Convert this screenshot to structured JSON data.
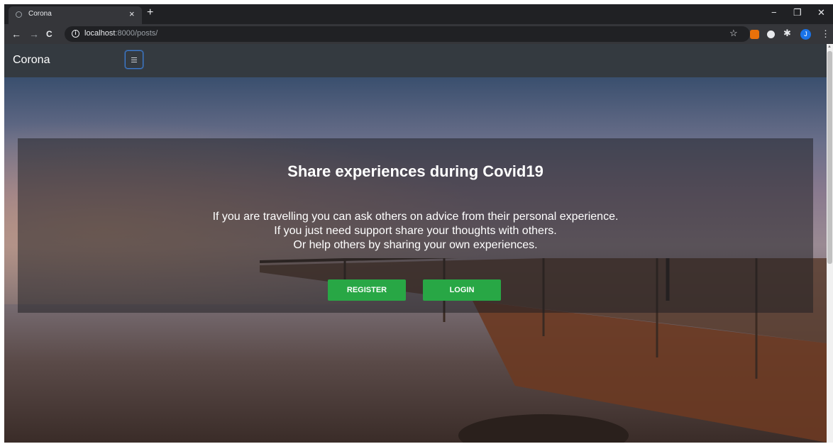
{
  "browser": {
    "tab_title": "Corona",
    "tab_close": "×",
    "new_tab": "+",
    "url_host": "localhost",
    "url_rest": ":8000/posts/",
    "info_icon_glyph": "i",
    "back_glyph": "←",
    "forward_glyph": "→",
    "reload_glyph": "C",
    "star_glyph": "☆",
    "window_controls": [
      "−",
      "❐",
      "✕"
    ],
    "extension_colors": [
      "#e8710a",
      "#e8eaed",
      "#e8eaed",
      "#1a73e8"
    ],
    "profile_initial": "J"
  },
  "navbar": {
    "brand": "Corona"
  },
  "hero": {
    "headline": "Share experiences during Covid19",
    "lines": [
      "If you are travelling you can ask others on advice from their personal experience.",
      "If you just need support share your thoughts with others.",
      "Or help others by sharing your own experiences."
    ],
    "register_label": "REGISTER",
    "login_label": "LOGIN"
  },
  "colors": {
    "navbar_bg": "#343a40",
    "button_green": "#28a745",
    "chrome_dark": "#202124"
  }
}
